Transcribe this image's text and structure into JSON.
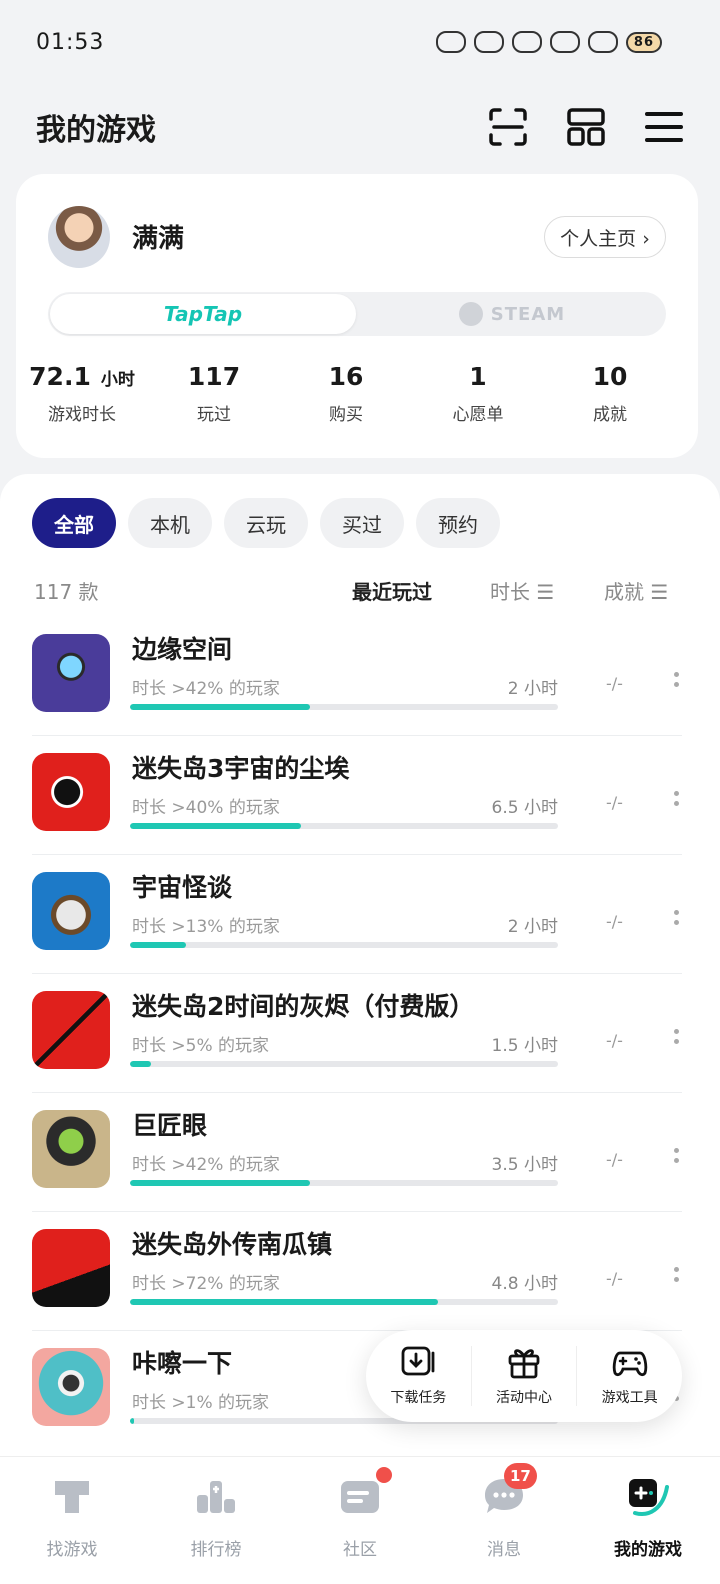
{
  "status_bar": {
    "time": "01:53",
    "battery": "86"
  },
  "header": {
    "title": "我的游戏",
    "icons": [
      "scan-icon",
      "grid-icon",
      "menu-icon"
    ]
  },
  "profile": {
    "username": "满满",
    "home_button": "个人主页 ›",
    "platforms": {
      "taptap": "TapTap",
      "steam": "STEAM",
      "selected": "TapTap"
    },
    "stats": [
      {
        "value": "72.1",
        "unit": "小时",
        "label": "游戏时长"
      },
      {
        "value": "117",
        "unit": "",
        "label": "玩过"
      },
      {
        "value": "16",
        "unit": "",
        "label": "购买"
      },
      {
        "value": "1",
        "unit": "",
        "label": "心愿单"
      },
      {
        "value": "10",
        "unit": "",
        "label": "成就"
      }
    ]
  },
  "filters": {
    "chips": [
      "全部",
      "本机",
      "云玩",
      "买过",
      "预约"
    ],
    "selected": "全部"
  },
  "sort": {
    "count": "117 款",
    "recent": "最近玩过",
    "duration": "时长 ☰",
    "achievement": "成就 ☰"
  },
  "games": [
    {
      "name": "边缘空间",
      "sub": "时长 >42% 的玩家",
      "hours": "2 小时",
      "achievement": "-/-",
      "progress": 0.42
    },
    {
      "name": "迷失岛3宇宙的尘埃",
      "sub": "时长 >40% 的玩家",
      "hours": "6.5 小时",
      "achievement": "-/-",
      "progress": 0.4
    },
    {
      "name": "宇宙怪谈",
      "sub": "时长 >13% 的玩家",
      "hours": "2 小时",
      "achievement": "-/-",
      "progress": 0.13
    },
    {
      "name": "迷失岛2时间的灰烬（付费版）",
      "sub": "时长 >5% 的玩家",
      "hours": "1.5 小时",
      "achievement": "-/-",
      "progress": 0.05
    },
    {
      "name": "巨匠眼",
      "sub": "时长 >42% 的玩家",
      "hours": "3.5 小时",
      "achievement": "-/-",
      "progress": 0.42
    },
    {
      "name": "迷失岛外传南瓜镇",
      "sub": "时长 >72% 的玩家",
      "hours": "4.8 小时",
      "achievement": "-/-",
      "progress": 0.72
    },
    {
      "name": "咔嚓一下",
      "sub": "时长 >1% 的玩家",
      "hours": "",
      "achievement": "",
      "progress": 0.01
    }
  ],
  "floating_menu": [
    {
      "label": "下载任务",
      "icon": "download-icon"
    },
    {
      "label": "活动中心",
      "icon": "gift-icon"
    },
    {
      "label": "游戏工具",
      "icon": "gamepad-icon"
    }
  ],
  "tabbar": {
    "tabs": [
      {
        "label": "找游戏",
        "icon": "taptap-icon"
      },
      {
        "label": "排行榜",
        "icon": "ranking-icon"
      },
      {
        "label": "社区",
        "icon": "community-icon"
      },
      {
        "label": "消息",
        "icon": "message-icon"
      },
      {
        "label": "我的游戏",
        "icon": "my-games-icon"
      }
    ],
    "message_badge": "17",
    "selected": "我的游戏"
  },
  "colors": {
    "accent": "#1fc7b3",
    "chip_active": "#1e1e8a",
    "badge": "#f0504a"
  }
}
